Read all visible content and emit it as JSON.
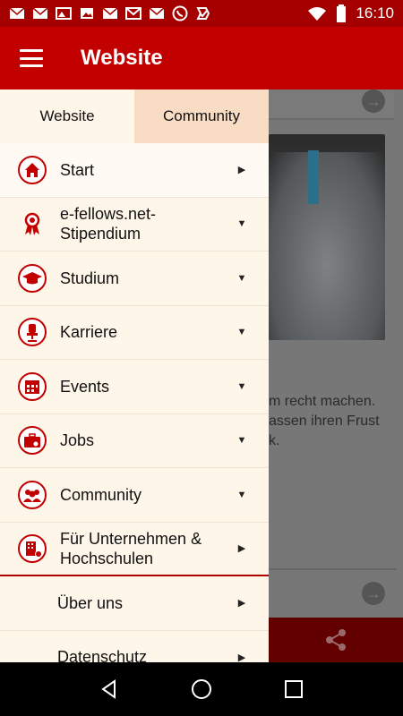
{
  "status_bar": {
    "time": "16:10",
    "icons": [
      "mail-icon",
      "mail-icon",
      "gallery-icon",
      "image-icon",
      "mail-icon",
      "gmail-icon",
      "mail-icon",
      "whatsapp-icon",
      "task-icon",
      "wifi-icon",
      "battery-icon"
    ]
  },
  "app_bar": {
    "title": "Website",
    "menu_icon": "hamburger-menu-icon"
  },
  "background": {
    "text": "m recht machen. assen ihren Frust k."
  },
  "drawer": {
    "tabs": [
      {
        "label": "Website",
        "active": true
      },
      {
        "label": "Community",
        "active": false
      }
    ],
    "items": [
      {
        "label": "Start",
        "icon": "home-icon",
        "chevron": "right"
      },
      {
        "label": "e-fellows.net-\nStipendium",
        "icon": "award-ribbon-icon",
        "chevron": "down"
      },
      {
        "label": "Studium",
        "icon": "graduation-cap-icon",
        "chevron": "down"
      },
      {
        "label": "Karriere",
        "icon": "office-chair-icon",
        "chevron": "down"
      },
      {
        "label": "Events",
        "icon": "calendar-icon",
        "chevron": "down"
      },
      {
        "label": "Jobs",
        "icon": "briefcase-icon",
        "chevron": "down"
      },
      {
        "label": "Community",
        "icon": "people-icon",
        "chevron": "down"
      },
      {
        "label": "Für Unternehmen &\nHochschulen",
        "icon": "building-icon",
        "chevron": "right"
      },
      {
        "label": "Über uns",
        "chevron": "right"
      },
      {
        "label": "Datenschutz",
        "chevron": "right"
      }
    ]
  },
  "colors": {
    "primary": "#c20000",
    "status_bar": "#a50000",
    "drawer_bg": "#fff6ea",
    "tab_inactive": "#f8dcc4"
  }
}
